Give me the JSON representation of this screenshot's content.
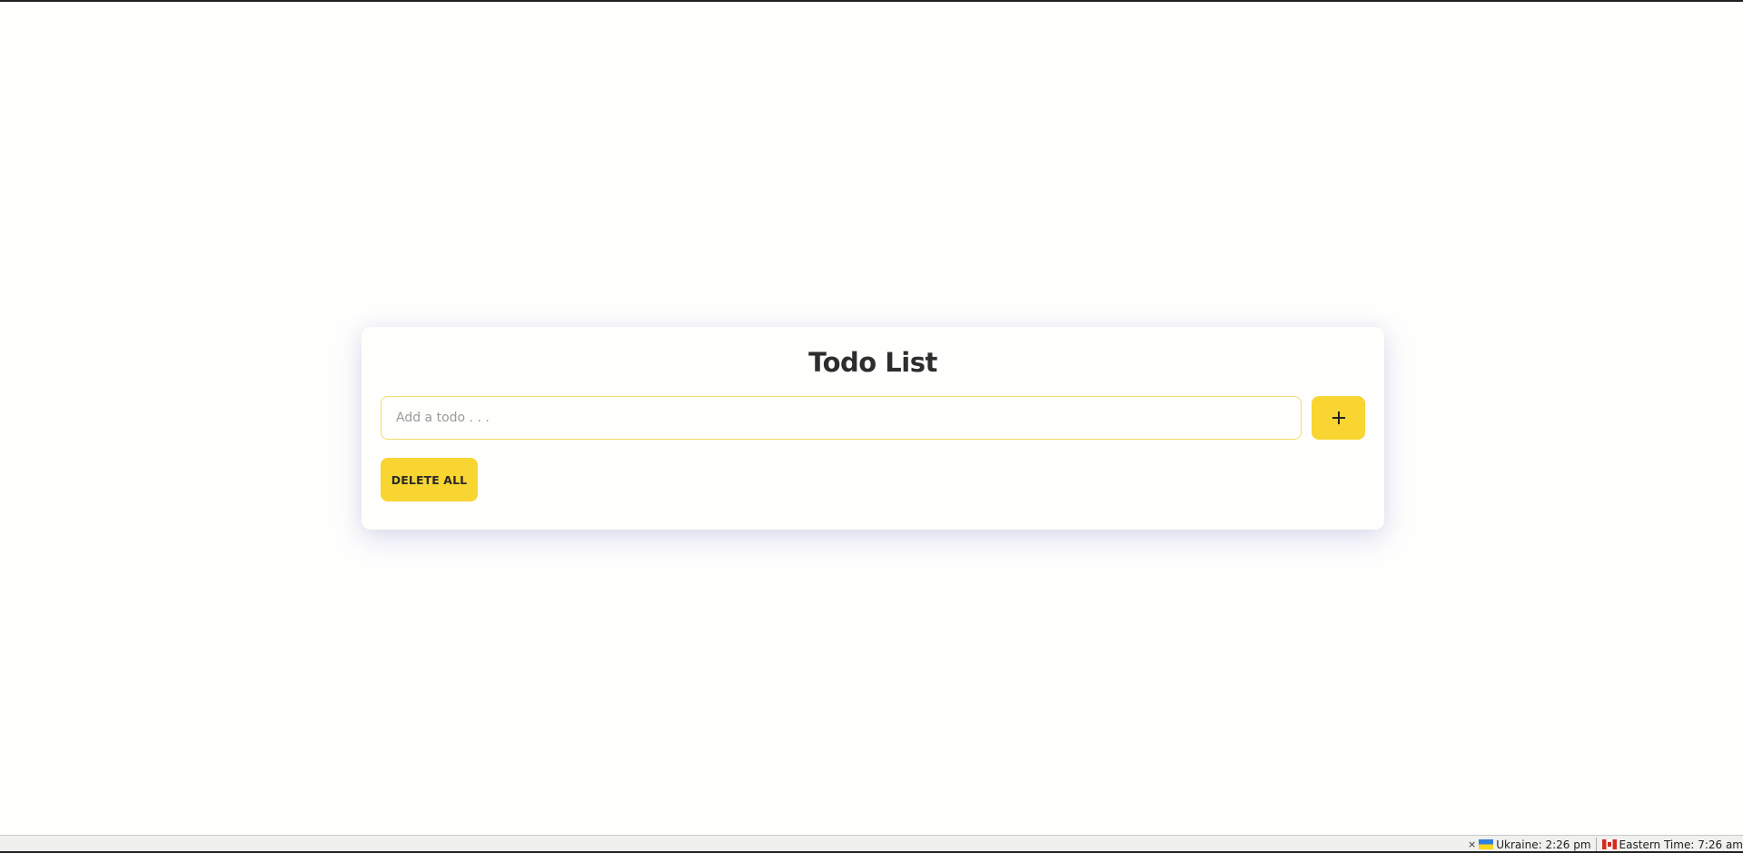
{
  "app": {
    "title": "Todo List"
  },
  "todo_input": {
    "value": "",
    "placeholder": "Add a todo . . ."
  },
  "buttons": {
    "add_icon": "plus-icon",
    "delete_all_label": "DELETE ALL"
  },
  "taskbar": {
    "close_glyph": "×",
    "clocks": [
      {
        "flag": "ukraine-flag-icon",
        "label": "Ukraine: 2:26 pm"
      },
      {
        "flag": "canada-flag-icon",
        "label": "Eastern Time: 7:26 am"
      }
    ]
  },
  "colors": {
    "accent": "#f8d531",
    "title_text": "#2d2d2d",
    "input_border": "#f3dc6a",
    "background": "#fefefd"
  }
}
